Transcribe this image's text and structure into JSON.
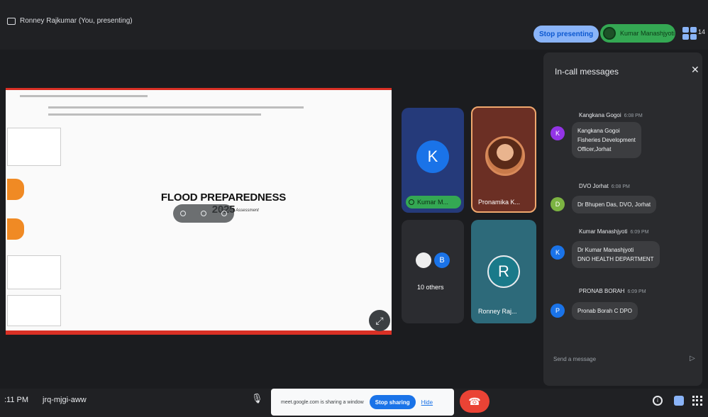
{
  "header": {
    "presenter_label": "Ronney Rajkumar (You, presenting)",
    "stop_presenting_label": "Stop presenting",
    "speaker_pill_name": "Kumar Manashjyoti",
    "participant_count": "14"
  },
  "slide": {
    "title": "FLOOD PREPAREDNESS 2025",
    "subtitle": "Damage Assessment"
  },
  "tiles": {
    "kumar": {
      "initial": "K",
      "name": "Kumar M..."
    },
    "pronamika": {
      "name": "Pronamika K..."
    },
    "others": {
      "initial": "B",
      "label": "10 others"
    },
    "ronney": {
      "initial": "R",
      "name": "Ronney Raj..."
    }
  },
  "chat": {
    "title": "In-call messages",
    "messages": [
      {
        "sender": "Kangkana Gogoi",
        "time": "6:08 PM",
        "initial": "K",
        "text": "Kangkana Gogoi\nFisheries Development\nOfficer,Jorhat"
      },
      {
        "sender": "DVO Jorhat",
        "time": "6:08 PM",
        "initial": "D",
        "text": "Dr Bhupen Das, DVO, Jorhat"
      },
      {
        "sender": "Kumar Manashjyoti",
        "time": "6:09 PM",
        "initial": "K",
        "text": "Dr Kumar Manashjyoti\nDNO HEALTH DEPARTMENT"
      },
      {
        "sender": "PRONAB BORAH",
        "time": "6:09 PM",
        "initial": "P",
        "text": "Pronab Borah C DPO"
      }
    ],
    "input_placeholder": "Send a message"
  },
  "bottom": {
    "time": ":11 PM",
    "meeting_code": "jrq-mjgi-aww",
    "share_text": "meet.google.com is sharing a window",
    "stop_sharing_label": "Stop sharing",
    "hide_label": "Hide"
  },
  "colors": {
    "accent_blue": "#8ab4f8",
    "green": "#34a853",
    "red": "#ea4335",
    "kumar_tile": "#253a7a",
    "ronney_tile": "#2d6a7a"
  }
}
